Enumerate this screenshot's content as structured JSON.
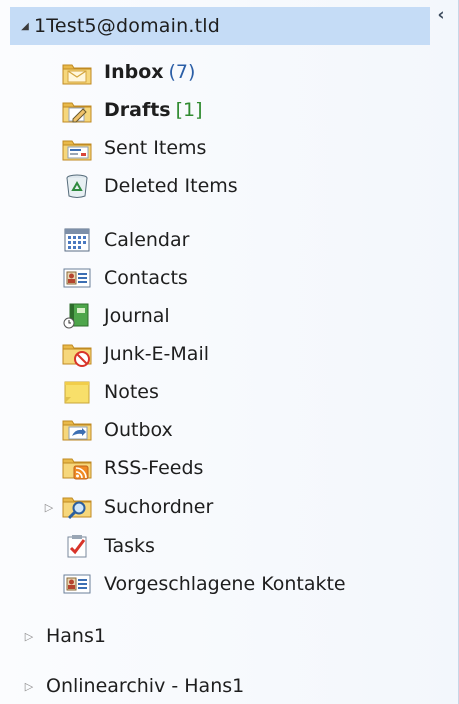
{
  "pane": {
    "collapse_glyph": "‹"
  },
  "account": {
    "expander_glyph": "◢",
    "label": "1Test5@domain.tld"
  },
  "folders": [
    {
      "label": "Inbox",
      "count": "(7)",
      "bold": true,
      "icon": "inbox-icon"
    },
    {
      "label": "Drafts",
      "count": "[1]",
      "bold": true,
      "icon": "drafts-icon"
    },
    {
      "label": "Sent Items",
      "count": "",
      "bold": false,
      "icon": "sent-items-icon"
    },
    {
      "label": "Deleted Items",
      "count": "",
      "bold": false,
      "icon": "deleted-items-icon"
    },
    {
      "label": "Calendar",
      "count": "",
      "bold": false,
      "icon": "calendar-icon"
    },
    {
      "label": "Contacts",
      "count": "",
      "bold": false,
      "icon": "contacts-icon"
    },
    {
      "label": "Journal",
      "count": "",
      "bold": false,
      "icon": "journal-icon"
    },
    {
      "label": "Junk-E-Mail",
      "count": "",
      "bold": false,
      "icon": "junk-email-icon"
    },
    {
      "label": "Notes",
      "count": "",
      "bold": false,
      "icon": "notes-icon"
    },
    {
      "label": "Outbox",
      "count": "",
      "bold": false,
      "icon": "outbox-icon"
    },
    {
      "label": "RSS-Feeds",
      "count": "",
      "bold": false,
      "icon": "rss-feeds-icon"
    },
    {
      "label": "Suchordner",
      "count": "",
      "bold": false,
      "icon": "search-folder-icon",
      "expandable": true
    },
    {
      "label": "Tasks",
      "count": "",
      "bold": false,
      "icon": "tasks-icon"
    },
    {
      "label": "Vorgeschlagene Kontakte",
      "count": "",
      "bold": false,
      "icon": "suggested-contacts-icon"
    }
  ],
  "stores": [
    {
      "expander_glyph": "▷",
      "label": "Hans1"
    },
    {
      "expander_glyph": "▷",
      "label": "Onlinearchiv - Hans1"
    }
  ],
  "sub_expander_glyph": "▷",
  "colors": {
    "selection": "#c5dcf6",
    "unread_count": "#2b5ea6",
    "draft_count": "#2f8a2f",
    "folder_yellow": "#f3cf6b"
  }
}
